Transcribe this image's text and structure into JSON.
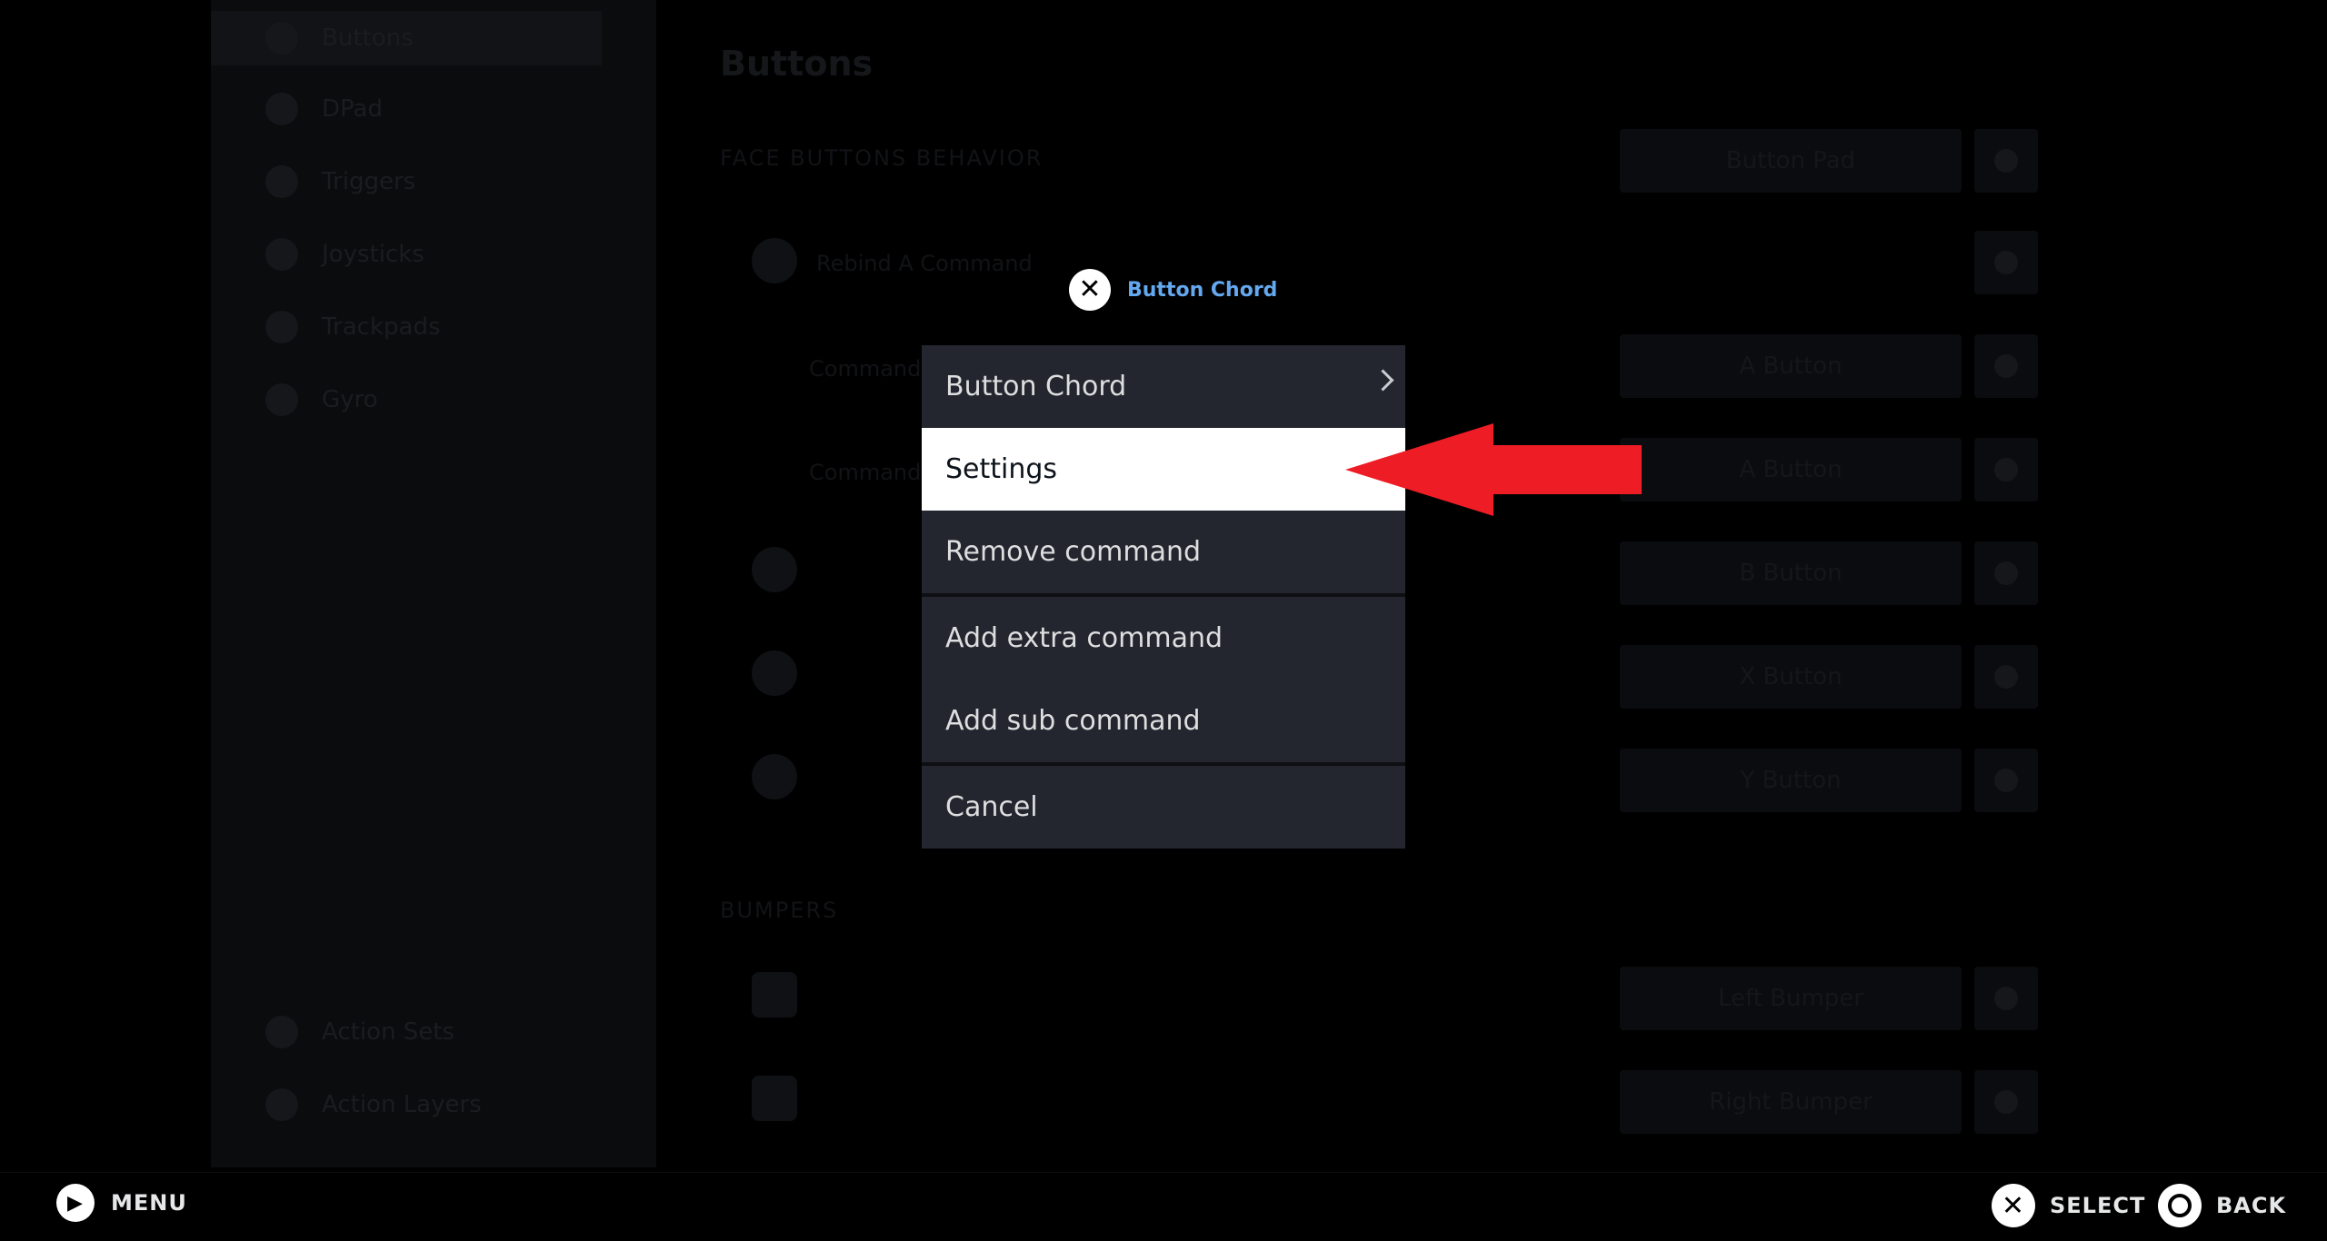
{
  "background": {
    "sidebar": [
      {
        "label": "Buttons",
        "icon": "gamepad-icon"
      },
      {
        "label": "DPad",
        "icon": "dpad-icon"
      },
      {
        "label": "Triggers",
        "icon": "trigger-icon"
      },
      {
        "label": "Joysticks",
        "icon": "joystick-icon"
      },
      {
        "label": "Trackpads",
        "icon": "trackpad-icon"
      },
      {
        "label": "Gyro",
        "icon": "gyro-icon"
      }
    ],
    "sidebar_bottom": [
      {
        "label": "Action Sets",
        "icon": "layers-icon"
      },
      {
        "label": "Action Layers",
        "icon": "layers-icon"
      }
    ],
    "title": "Buttons",
    "section_face": "FACE BUTTONS BEHAVIOR",
    "face_behavior_value": "Button Pad",
    "rows": [
      {
        "label": "Rebind A Command",
        "value": ""
      },
      {
        "label": "Command",
        "value": "A Button"
      },
      {
        "label": "Command",
        "value": "A Button"
      },
      {
        "label": "",
        "value": "B Button"
      },
      {
        "label": "",
        "value": "X Button"
      },
      {
        "label": "",
        "value": "Y Button"
      }
    ],
    "section_bumpers": "BUMPERS",
    "bumper_rows": [
      {
        "value": "Left Bumper"
      },
      {
        "value": "Right Bumper"
      }
    ]
  },
  "modal": {
    "title": "Button Chord",
    "items": [
      {
        "label": "Button Chord",
        "has_submenu": true
      },
      {
        "label": "Settings",
        "selected": true
      },
      {
        "label": "Remove command"
      },
      {
        "label": "Add extra command"
      },
      {
        "label": "Add sub command"
      },
      {
        "label": "Cancel"
      }
    ]
  },
  "annotation": {
    "color": "#ee1c25"
  },
  "footer": {
    "menu_label": "MENU",
    "select_label": "SELECT",
    "back_label": "BACK"
  }
}
